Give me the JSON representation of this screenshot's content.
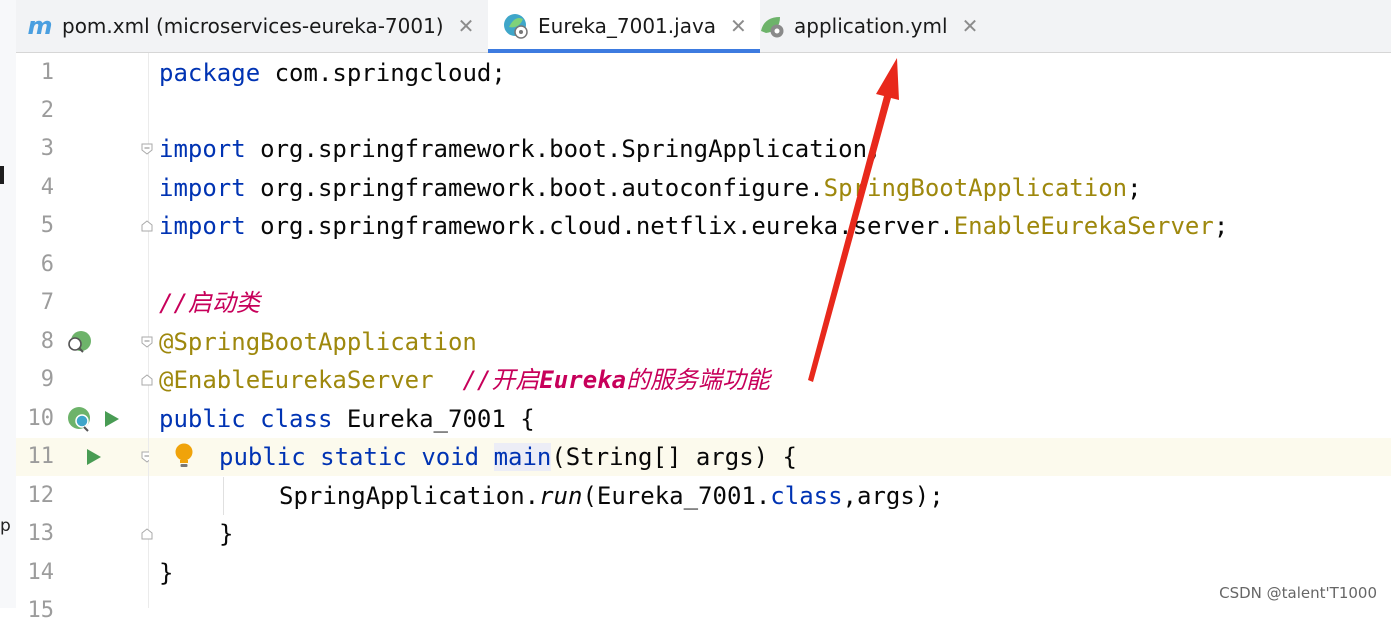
{
  "tabs": [
    {
      "label": "pom.xml (microservices-eureka-7001)",
      "icon": "maven-icon",
      "active": false
    },
    {
      "label": "Eureka_7001.java",
      "icon": "spring-class-icon",
      "active": true
    },
    {
      "label": "application.yml",
      "icon": "spring-config-icon",
      "active": false
    }
  ],
  "close_glyph": "✕",
  "left_strip_fragment": "p",
  "line_numbers": [
    "1",
    "2",
    "3",
    "4",
    "5",
    "6",
    "7",
    "8",
    "9",
    "10",
    "11",
    "12",
    "13",
    "14",
    "15"
  ],
  "code": {
    "l1_kw": "package",
    "l1_rest": " com.springcloud;",
    "l3_kw": "import",
    "l3_rest": " org.springframework.boot.SpringApplication;",
    "l4_kw": "import",
    "l4_pkg": " org.springframework.boot.autoconfigure.",
    "l4_cls": "SpringBootApplication",
    "l4_end": ";",
    "l5_kw": "import",
    "l5_pkg": " org.springframework.cloud.netflix.eureka.server.",
    "l5_cls": "EnableEurekaServer",
    "l5_end": ";",
    "l7_comment": "//启动类",
    "l8_ann": "@SpringBootApplication",
    "l9_ann": "@EnableEurekaServer",
    "l9_comment_a": "//开启",
    "l9_comment_b": "Eureka",
    "l9_comment_c": "的服务端功能",
    "l10_kw1": "public",
    "l10_kw2": "class",
    "l10_rest": " Eureka_7001 {",
    "l11_kw1": "public",
    "l11_kw2": "static",
    "l11_kw3": "void",
    "l11_method": "main",
    "l11_rest": "(String[] args) {",
    "l12_a": "SpringApplication.",
    "l12_run": "run",
    "l12_b": "(Eureka_7001.",
    "l12_cls": "class",
    "l12_c": ",args);",
    "l13": "}",
    "l14": "}"
  },
  "watermark": "CSDN @talent'T1000",
  "colors": {
    "keyword": "#0033b3",
    "annotation": "#9e880d",
    "comment": "#c7005a",
    "arrow": "#e8291c",
    "active_tab_underline": "#3d7be0"
  }
}
